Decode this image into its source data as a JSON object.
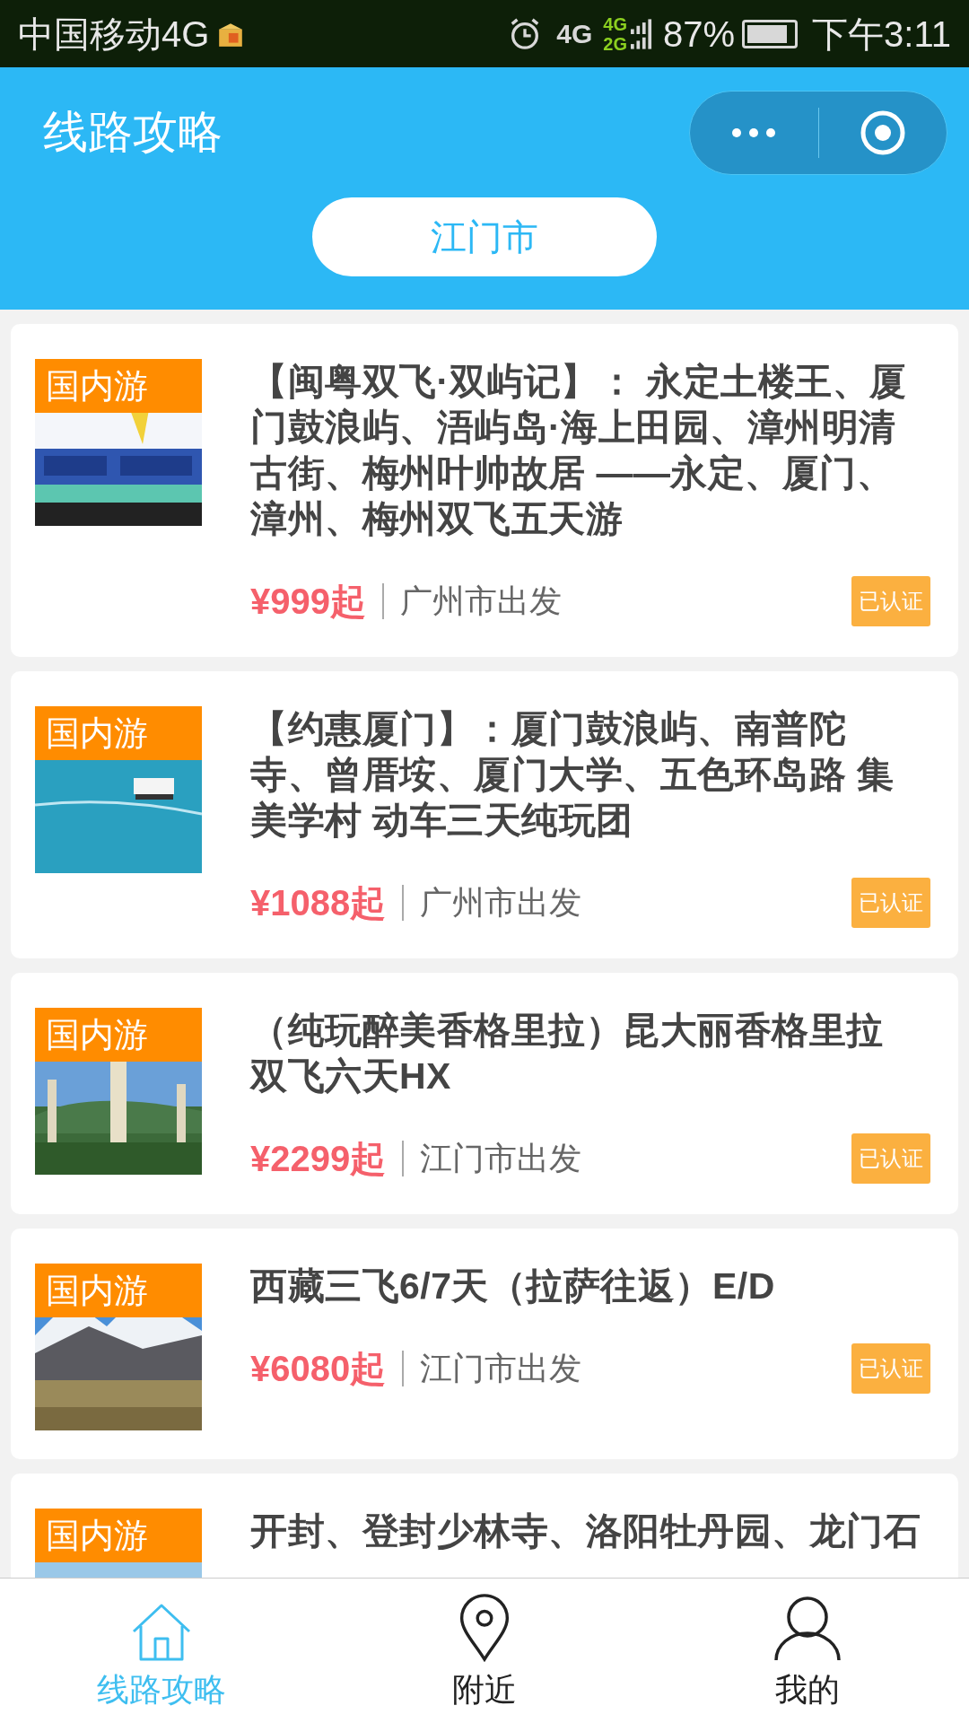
{
  "status_bar": {
    "carrier": "中国移动4G",
    "network": "4G",
    "network_small": [
      "4G",
      "2G"
    ],
    "battery": "87%",
    "time": "下午3:11"
  },
  "header": {
    "title": "线路攻略",
    "city": "江门市"
  },
  "routes": [
    {
      "tag": "国内游",
      "title": "【闽粤双飞·双屿记】： 永定土楼王、厦门鼓浪屿、浯屿岛·海上田园、漳州明清古街、梅州叶帅故居 ——永定、厦门、漳州、梅州双飞五天游",
      "price": "¥999起",
      "departure": "广州市出发",
      "badge": "已认证"
    },
    {
      "tag": "国内游",
      "title": "【约惠厦门】：厦门鼓浪屿、南普陀寺、曾厝垵、厦门大学、五色环岛路 集美学村 动车三天纯玩团",
      "price": "¥1088起",
      "departure": "广州市出发",
      "badge": "已认证"
    },
    {
      "tag": "国内游",
      "title": "（纯玩醉美香格里拉）昆大丽香格里拉双飞六天HX",
      "price": "¥2299起",
      "departure": "江门市出发",
      "badge": "已认证"
    },
    {
      "tag": "国内游",
      "title": "西藏三飞6/7天（拉萨往返）E/D",
      "price": "¥6080起",
      "departure": "江门市出发",
      "badge": "已认证"
    },
    {
      "tag": "国内游",
      "title": "开封、登封少林寺、洛阳牡丹园、龙门石"
    }
  ],
  "tab_bar": [
    {
      "label": "线路攻略",
      "kind": "home",
      "selected": true
    },
    {
      "label": "附近",
      "kind": "pin",
      "selected": false
    },
    {
      "label": "我的",
      "kind": "user",
      "selected": false
    }
  ]
}
